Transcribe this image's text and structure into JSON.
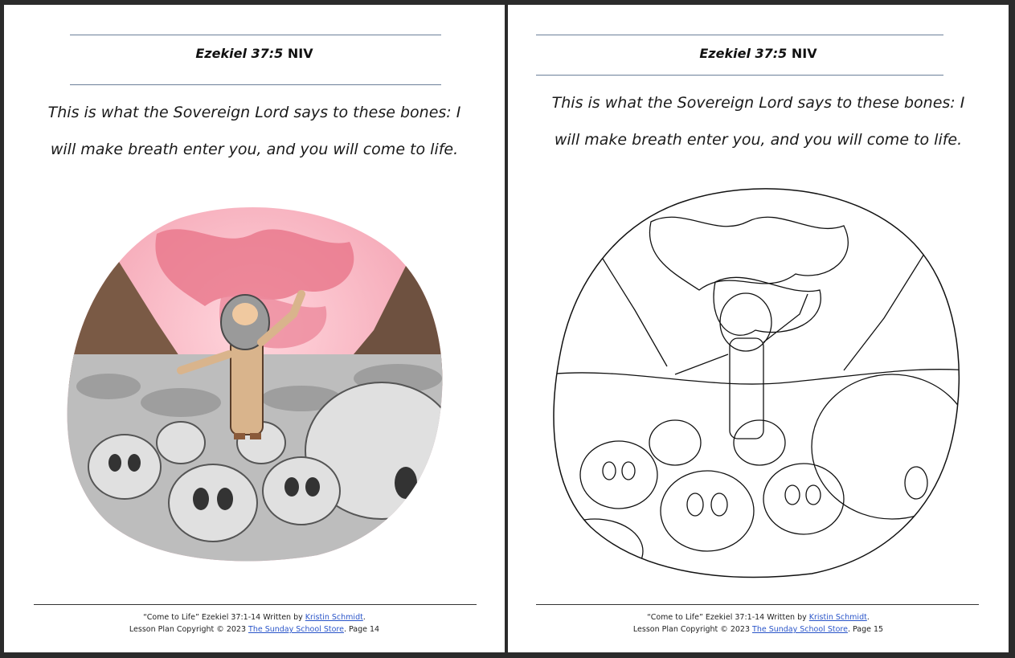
{
  "pages": [
    {
      "heading_book": "Ezekiel 37:5",
      "heading_version": "NIV",
      "verse_line1": "This is what the Sovereign Lord says to these bones: I",
      "verse_line2": "will make breath enter you, and you will come to life.",
      "footer_line1_prefix": "“Come to Life” Ezekiel 37:1-14  Written by ",
      "footer_author": "Kristin Schmidt",
      "footer_line1_suffix": ".",
      "footer_line2_prefix": "Lesson Plan Copyright © 2023 ",
      "footer_store": "The Sunday School Store",
      "footer_line2_suffix": ". Page 14"
    },
    {
      "heading_book": "Ezekiel 37:5",
      "heading_version": "NIV",
      "verse_line1": "This is what the Sovereign Lord says to these bones: I",
      "verse_line2": "will make breath enter you, and you will come to life.",
      "footer_line1_prefix": "“Come to Life” Ezekiel 37:1-14  Written by ",
      "footer_author": "Kristin Schmidt",
      "footer_line1_suffix": ".",
      "footer_line2_prefix": "Lesson Plan Copyright © 2023 ",
      "footer_store": "The Sunday School Store",
      "footer_line2_suffix": ". Page 15"
    }
  ],
  "illustrations": {
    "left": {
      "icon": "ezekiel-valley-of-bones-color-illustration",
      "colors": {
        "sky": "#f4a7b4",
        "cloud": "#e86c82",
        "bones": "#cfcfcf",
        "cliff": "#7a5a45"
      }
    },
    "right": {
      "icon": "ezekiel-valley-of-bones-coloring-page",
      "colors": {
        "line": "#111111"
      }
    }
  }
}
